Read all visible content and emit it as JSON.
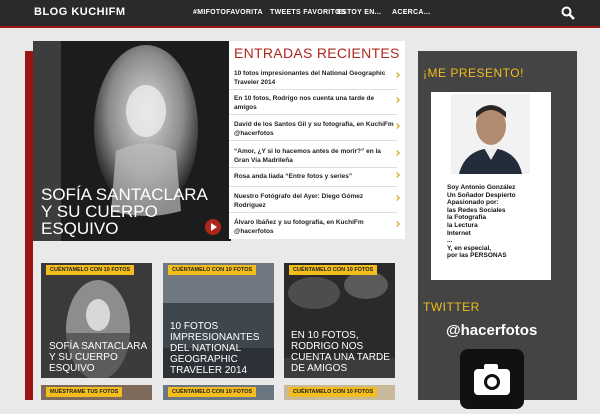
{
  "header": {
    "brand": "BLOG KUCHIFM",
    "nav": [
      "#MIFOTOFAVORITA",
      "TWEETS FAVORITOS",
      "ESTOY EN...",
      "ACERCA..."
    ],
    "search_icon": "search-icon"
  },
  "featured": {
    "title": "SOFÍA SANTACLARA Y SU CUERPO ESQUIVO",
    "arrow_icon": "play-arrow-icon"
  },
  "recent": {
    "heading": "ENTRADAS RECIENTES",
    "items": [
      "10 fotos impresionantes del National Geographic Traveler 2014",
      "En 10 fotos, Rodrigo nos cuenta una tarde de amigos",
      "David de los Santos Gil y su fotografía, en KuchiFm @hacerfotos",
      "“Amor, ¿Y si lo hacemos antes de morir?” en la Gran Vía Madrileña",
      "Rosa anda liada “Entre fotos y series”",
      "Nuestro Fotógrafo del Ayer: Diego Gómez Rodriguez",
      "Álvaro Ibáñez y su fotografía, en KuchiFm @hacerfotos"
    ]
  },
  "tiles": [
    {
      "tag": "CUÉNTAMELO CON 10 FOTOS",
      "caption": "SOFÍA SANTACLARA Y SU CUERPO ESQUIVO"
    },
    {
      "tag": "CUÉNTAMELO CON 10 FOTOS",
      "caption": "10 FOTOS IMPRESIONANTES DEL NATIONAL GEOGRAPHIC TRAVELER 2014"
    },
    {
      "tag": "CUÉNTAMELO CON 10 FOTOS",
      "caption": "EN 10 FOTOS, RODRIGO NOS CUENTA UNA TARDE DE AMIGOS"
    },
    {
      "tag": "MUÉSTRAME TUS FOTOS",
      "caption": ""
    },
    {
      "tag": "CUÉNTAMELO CON 10 FOTOS",
      "caption": ""
    },
    {
      "tag": "CUÉNTAMELO CON 10 FOTOS",
      "caption": ""
    }
  ],
  "sidebar": {
    "about_heading": "¡ME PRESENTO!",
    "about_text": "Soy Antonio González\nUn Soñador Despierto\nApasionado por:\nlas Redes Sociales\nla Fotografía\nla Lectura\nInternet\n...\nY, en especial,\npor las PERSONAS",
    "twitter_heading": "TWITTER",
    "twitter_handle": "@hacerfotos",
    "camera_icon": "camera-icon"
  },
  "colors": {
    "accent_red": "#b0251c",
    "accent_yellow": "#f2bd1d",
    "header_bg": "#2a2a2a"
  }
}
